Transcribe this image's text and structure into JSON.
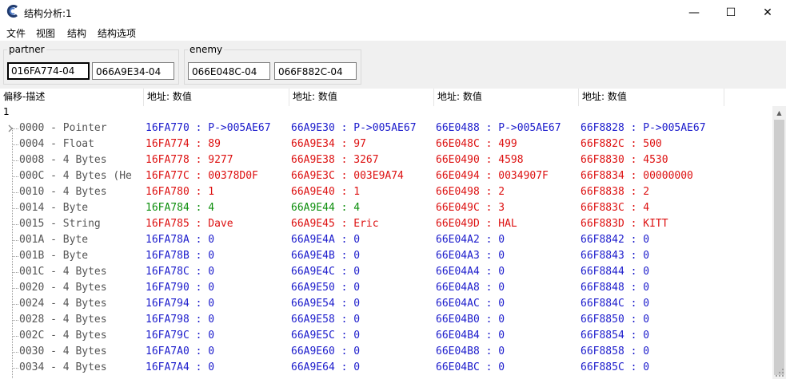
{
  "window": {
    "title": "结构分析:1",
    "minimize_glyph": "—",
    "maximize_glyph": "☐",
    "close_glyph": "✕"
  },
  "menu": [
    "文件",
    "视图",
    "结构",
    "结构选项"
  ],
  "groups": [
    {
      "label": "partner",
      "addresses": [
        "016FA774-04",
        "066A9E34-04"
      ]
    },
    {
      "label": "enemy",
      "addresses": [
        "066E048C-04",
        "066F882C-04"
      ]
    }
  ],
  "headers": [
    "偏移-描述",
    "地址: 数值",
    "地址: 数值",
    "地址: 数值",
    "地址: 数值"
  ],
  "root_label": "1",
  "rows": [
    {
      "desc": "0000 - Pointer",
      "color": "blue",
      "cols": [
        "16FA770 : P->005AE67",
        "66A9E30 : P->005AE67",
        "66E0488 : P->005AE67",
        "66F8828 : P->005AE67"
      ]
    },
    {
      "desc": "0004 - Float",
      "color": "red",
      "cols": [
        "16FA774 : 89",
        "66A9E34 : 97",
        "66E048C : 499",
        "66F882C : 500"
      ]
    },
    {
      "desc": "0008 - 4 Bytes",
      "color": "red",
      "cols": [
        "16FA778 : 9277",
        "66A9E38 : 3267",
        "66E0490 : 4598",
        "66F8830 : 4530"
      ]
    },
    {
      "desc": "000C - 4 Bytes (He",
      "color": "red",
      "cols": [
        "16FA77C : 00378D0F",
        "66A9E3C : 003E9A74",
        "66E0494 : 0034907F",
        "66F8834 : 00000000"
      ]
    },
    {
      "desc": "0010 - 4 Bytes",
      "color": "red",
      "cols": [
        "16FA780 : 1",
        "66A9E40 : 1",
        "66E0498 : 2",
        "66F8838 : 2"
      ]
    },
    {
      "desc": "0014 - Byte",
      "colors": [
        "green",
        "green",
        "red",
        "red"
      ],
      "cols": [
        "16FA784 : 4",
        "66A9E44 : 4",
        "66E049C : 3",
        "66F883C : 4"
      ]
    },
    {
      "desc": "0015 - String",
      "color": "red",
      "cols": [
        "16FA785 : Dave",
        "66A9E45 : Eric",
        "66E049D : HAL",
        "66F883D : KITT"
      ]
    },
    {
      "desc": "001A - Byte",
      "color": "blue",
      "cols": [
        "16FA78A : 0",
        "66A9E4A : 0",
        "66E04A2 : 0",
        "66F8842 : 0"
      ]
    },
    {
      "desc": "001B - Byte",
      "color": "blue",
      "cols": [
        "16FA78B : 0",
        "66A9E4B : 0",
        "66E04A3 : 0",
        "66F8843 : 0"
      ]
    },
    {
      "desc": "001C - 4 Bytes",
      "color": "blue",
      "cols": [
        "16FA78C : 0",
        "66A9E4C : 0",
        "66E04A4 : 0",
        "66F8844 : 0"
      ]
    },
    {
      "desc": "0020 - 4 Bytes",
      "color": "blue",
      "cols": [
        "16FA790 : 0",
        "66A9E50 : 0",
        "66E04A8 : 0",
        "66F8848 : 0"
      ]
    },
    {
      "desc": "0024 - 4 Bytes",
      "color": "blue",
      "cols": [
        "16FA794 : 0",
        "66A9E54 : 0",
        "66E04AC : 0",
        "66F884C : 0"
      ]
    },
    {
      "desc": "0028 - 4 Bytes",
      "color": "blue",
      "cols": [
        "16FA798 : 0",
        "66A9E58 : 0",
        "66E04B0 : 0",
        "66F8850 : 0"
      ]
    },
    {
      "desc": "002C - 4 Bytes",
      "color": "blue",
      "cols": [
        "16FA79C : 0",
        "66A9E5C : 0",
        "66E04B4 : 0",
        "66F8854 : 0"
      ]
    },
    {
      "desc": "0030 - 4 Bytes",
      "color": "blue",
      "cols": [
        "16FA7A0 : 0",
        "66A9E60 : 0",
        "66E04B8 : 0",
        "66F8858 : 0"
      ]
    },
    {
      "desc": "0034 - 4 Bytes",
      "color": "blue",
      "cols": [
        "16FA7A4 : 0",
        "66A9E64 : 0",
        "66E04BC : 0",
        "66F885C : 0"
      ]
    }
  ],
  "colors": {
    "blue": "#1c1ccc",
    "red": "#dd1111",
    "green": "#0e8f0e"
  }
}
